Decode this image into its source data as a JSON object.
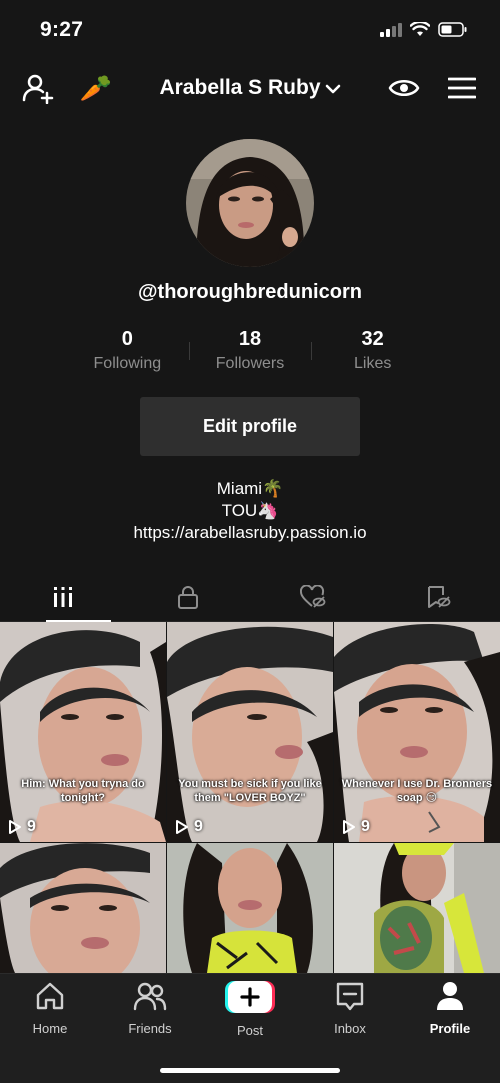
{
  "status_bar": {
    "time": "9:27"
  },
  "header": {
    "username": "Arabella S Ruby",
    "add_user_icon": "add-user-icon",
    "carrot_emoji": "🥕"
  },
  "profile": {
    "handle": "@thoroughbredunicorn",
    "stats": [
      {
        "value": "0",
        "label": "Following"
      },
      {
        "value": "18",
        "label": "Followers"
      },
      {
        "value": "32",
        "label": "Likes"
      }
    ],
    "edit_label": "Edit profile",
    "bio": {
      "line1": "Miami🌴",
      "line2": "TOU🦄",
      "link": "https://arabellasruby.passion.io"
    }
  },
  "tabs": [
    "videos",
    "private",
    "liked",
    "favorites"
  ],
  "videos": [
    {
      "caption": "Him: What you tryna do tonight?",
      "views": "9"
    },
    {
      "caption": "You must be sick if you like them \"LOVER BOYZ\"",
      "views": "9"
    },
    {
      "caption": "Whenever I use Dr. Bronners soap 😏",
      "views": "9"
    },
    {
      "caption": "",
      "views": ""
    },
    {
      "caption": "",
      "views": ""
    },
    {
      "caption": "",
      "views": ""
    }
  ],
  "nav": [
    {
      "label": "Home"
    },
    {
      "label": "Friends"
    },
    {
      "label": "Post"
    },
    {
      "label": "Inbox"
    },
    {
      "label": "Profile"
    }
  ],
  "colors": {
    "background": "#161616",
    "post_left": "#25f4ee",
    "post_right": "#fe2c55"
  }
}
